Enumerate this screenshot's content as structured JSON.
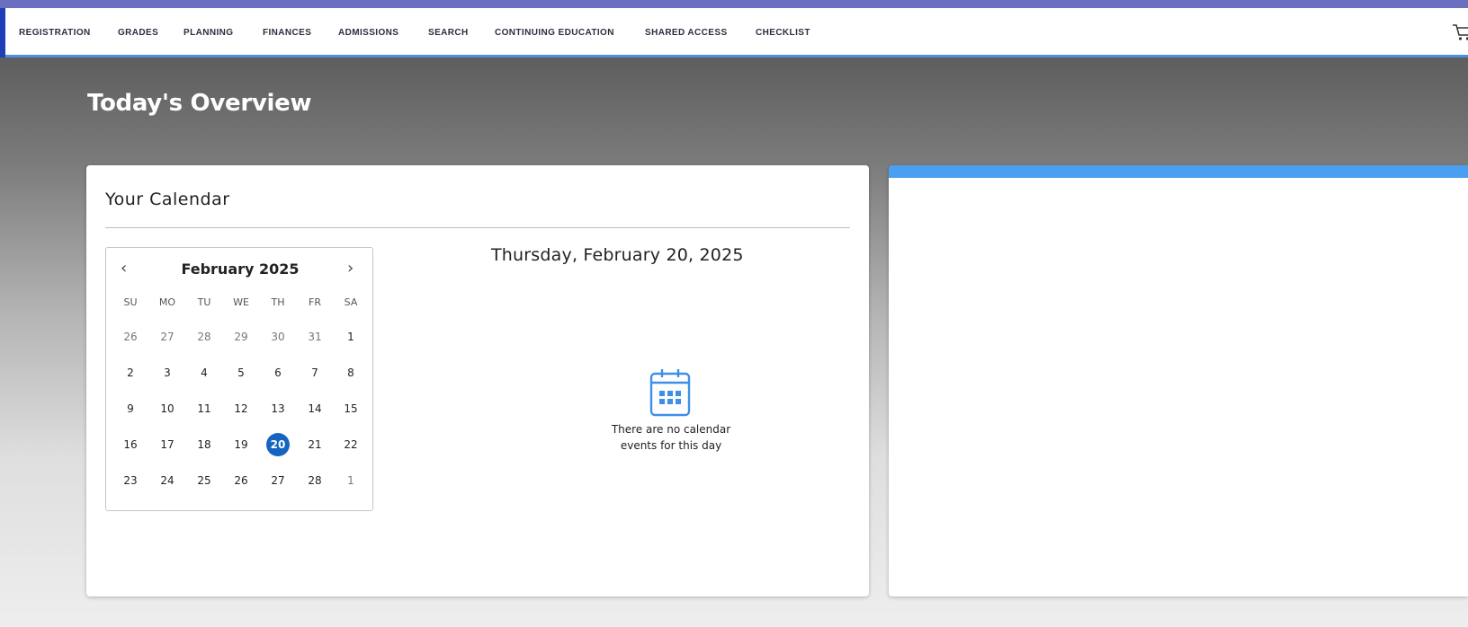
{
  "nav": {
    "items": [
      "REGISTRATION",
      "GRADES",
      "PLANNING",
      "FINANCES",
      "ADMISSIONS",
      "SEARCH",
      "CONTINUING EDUCATION",
      "SHARED ACCESS",
      "CHECKLIST"
    ],
    "cart_icon": "cart-icon"
  },
  "page": {
    "title": "Today's Overview"
  },
  "calendar_card": {
    "title": "Your Calendar",
    "month_label": "February 2025",
    "prev_icon": "chevron-left-icon",
    "next_icon": "chevron-right-icon",
    "weekdays": [
      "SU",
      "MO",
      "TU",
      "WE",
      "TH",
      "FR",
      "SA"
    ],
    "weeks": [
      [
        "26",
        "27",
        "28",
        "29",
        "30",
        "31",
        "1"
      ],
      [
        "2",
        "3",
        "4",
        "5",
        "6",
        "7",
        "8"
      ],
      [
        "9",
        "10",
        "11",
        "12",
        "13",
        "14",
        "15"
      ],
      [
        "16",
        "17",
        "18",
        "19",
        "20",
        "21",
        "22"
      ],
      [
        "23",
        "24",
        "25",
        "26",
        "27",
        "28",
        "1"
      ]
    ],
    "selected_day": "20",
    "selected_date_heading": "Thursday, February 20, 2025",
    "empty_icon": "calendar-icon",
    "empty_message": "There are no calendar events for this day"
  },
  "colors": {
    "accent": "#4a9ff0",
    "selected_day": "#1565c0",
    "nav_border": "#4a8fe0",
    "top_bar": "#6a6fc0"
  }
}
